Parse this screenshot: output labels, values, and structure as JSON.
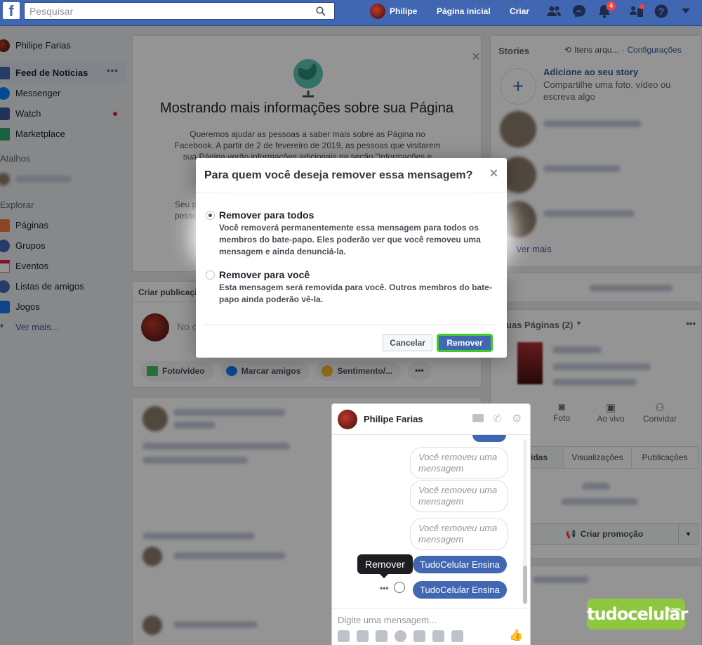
{
  "topbar": {
    "logo": "f",
    "search_placeholder": "Pesquisar",
    "user_name": "Philipe",
    "home": "Página inicial",
    "create": "Criar",
    "notifications_count": "4"
  },
  "leftnav": {
    "profile": "Philipe Farias",
    "items": [
      {
        "label": "Feed de Notícias"
      },
      {
        "label": "Messenger"
      },
      {
        "label": "Watch"
      },
      {
        "label": "Marketplace"
      }
    ],
    "shortcuts_title": "Atalhos",
    "explore_title": "Explorar",
    "explore": [
      {
        "label": "Páginas"
      },
      {
        "label": "Grupos"
      },
      {
        "label": "Eventos"
      },
      {
        "label": "Listas de amigos"
      },
      {
        "label": "Jogos"
      }
    ],
    "see_more": "Ver mais..."
  },
  "info_card": {
    "title": "Mostrando mais informações sobre sua Página",
    "body": "Queremos ajudar as pessoas a saber mais sobre as Página no Facebook. A partir de 2 de fevereiro de 2019, as pessoas que visitarem sua Página verão informações adicionais na seção \"Informações e anún",
    "body_fragment_1": "Seu p",
    "body_fragment_2": "pesso"
  },
  "composer": {
    "title": "Criar publicação",
    "placeholder": "No c",
    "actions": [
      "Foto/vídeo",
      "Marcar amigos",
      "Sentimento/..."
    ]
  },
  "right": {
    "stories_title": "Stories",
    "archived": "Itens arqu...",
    "settings": "Configurações",
    "add_story_title": "Adicione ao seu story",
    "add_story_desc": "Compartilhe uma foto, vídeo ou escreva algo",
    "see_more": "Ver mais",
    "pages_title": "uas Páginas (2)",
    "page_actions": [
      "ar",
      "Foto",
      "Ao vivo",
      "Convidar"
    ],
    "tabs": [
      "idas",
      "Visualizações",
      "Publicações"
    ],
    "promote": "Criar promoção"
  },
  "dialog": {
    "title": "Para quem você deseja remover essa mensagem?",
    "option1_title": "Remover para todos",
    "option1_desc": "Você removerá permanentemente essa mensagem para todos os membros do bate-papo. Eles poderão ver que você removeu uma mensagem e ainda denunciá-la.",
    "option2_title": "Remover para você",
    "option2_desc": "Esta mensagem será removida para você. Outros membros do bate-papo ainda poderão vê-la.",
    "cancel": "Cancelar",
    "remove": "Remover"
  },
  "chat": {
    "name": "Philipe Farias",
    "removed_msgs": [
      "Você removeu uma mensagem",
      "Você removeu uma mensagem",
      "Você removeu uma mensagem"
    ],
    "msg1": "TudoCelular Ensina",
    "msg2": "TudoCelular Ensina",
    "tooltip": "Remover",
    "input_placeholder": "Digite uma mensagem..."
  },
  "watermark": {
    "text": "tudocelular",
    "suffix": ".com"
  },
  "colors": {
    "brand": "#4267b2",
    "highlight": "#3ecc2b"
  }
}
